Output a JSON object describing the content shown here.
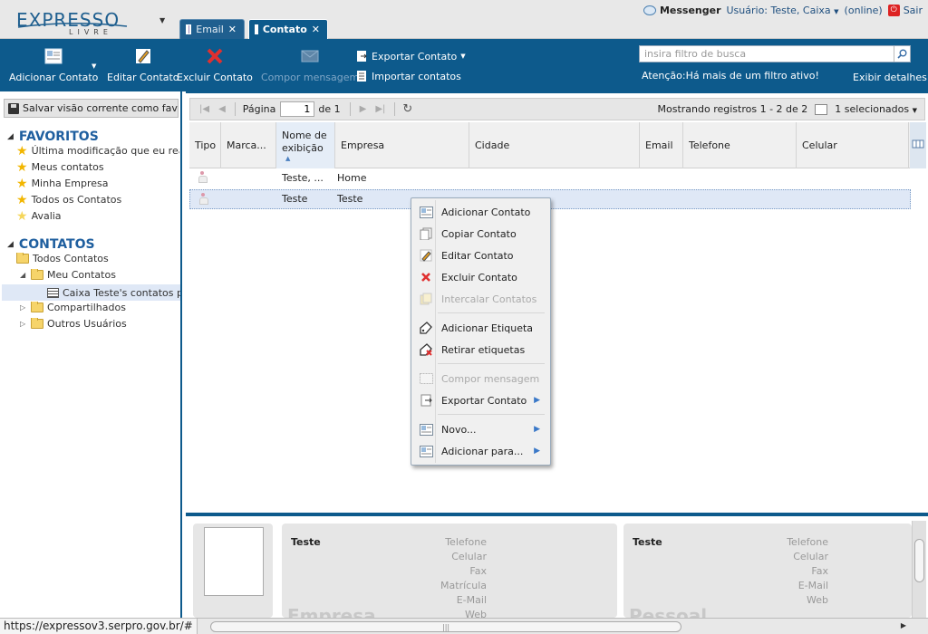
{
  "header": {
    "logo_main": "EXPRESSO",
    "logo_sub": "LIVRE",
    "tabs": [
      {
        "label": "Email",
        "close": "✕"
      },
      {
        "label": "Contato",
        "close": "✕"
      }
    ],
    "messenger": "Messenger",
    "user_label": "Usuário: Teste, Caixa",
    "status": "(online)",
    "logout": "Sair"
  },
  "toolbar": {
    "add_contact": "Adicionar Contato",
    "edit_contact": "Editar Contato",
    "delete_contact": "Excluir Contato",
    "compose": "Compor mensagem",
    "export": "Exportar Contato",
    "import": "Importar contatos",
    "search_placeholder": "insira filtro de busca",
    "warning": "Atenção:Há mais de um filtro ativo!",
    "details": "Exibir detalhes"
  },
  "sidebar": {
    "save_view": "Salvar visão corrente como favorito",
    "favorites_title": "FAVORITOS",
    "favorites": [
      "Última modificação que eu realizei",
      "Meus contatos",
      "Minha Empresa",
      "Todos os Contatos",
      "Avalia"
    ],
    "contacts_title": "CONTATOS",
    "tree": {
      "all": "Todos Contatos",
      "mine": "Meu Contatos",
      "personal": "Caixa Teste's contatos pessoais",
      "shared": "Compartilhados",
      "others": "Outros Usuários"
    }
  },
  "pager": {
    "page_label": "Página",
    "page_value": "1",
    "of": "de 1",
    "showing": "Mostrando registros 1 - 2 de 2",
    "selected": "1 selecionados"
  },
  "grid": {
    "columns": [
      "Tipo",
      "Marca...",
      "Nome de exibição",
      "Empresa",
      "Cidade",
      "Email",
      "Telefone",
      "Celular"
    ],
    "rows": [
      {
        "name": "Teste, ...",
        "company": "Home"
      },
      {
        "name": "Teste",
        "company": "Teste"
      }
    ]
  },
  "context_menu": {
    "items": [
      {
        "label": "Adicionar Contato",
        "icon": "add-contact-icon"
      },
      {
        "label": "Copiar Contato",
        "icon": "copy-icon"
      },
      {
        "label": "Editar Contato",
        "icon": "pencil-icon"
      },
      {
        "label": "Excluir Contato",
        "icon": "delete-x-icon"
      },
      {
        "label": "Intercalar Contatos",
        "icon": "merge-icon"
      },
      {
        "label": "Adicionar Etiqueta",
        "icon": "tag-icon"
      },
      {
        "label": "Retirar etiquetas",
        "icon": "tag-remove-icon"
      },
      {
        "label": "Compor mensagem",
        "icon": "compose-icon"
      },
      {
        "label": "Exportar Contato",
        "icon": "export-icon"
      },
      {
        "label": "Novo...",
        "icon": "new-icon"
      },
      {
        "label": "Adicionar para...",
        "icon": "add-to-icon"
      }
    ]
  },
  "preview": {
    "card1_name": "Teste",
    "card1_fields": [
      "Telefone",
      "Celular",
      "Fax",
      "Matrícula",
      "E-Mail",
      "Web"
    ],
    "card1_section": "Empresa",
    "card2_name": "Teste",
    "card2_fields": [
      "Telefone",
      "Celular",
      "Fax",
      "E-Mail",
      "Web"
    ],
    "card2_section": "Pessoal"
  },
  "status": {
    "url": "https://expressov3.serpro.gov.br/#"
  }
}
